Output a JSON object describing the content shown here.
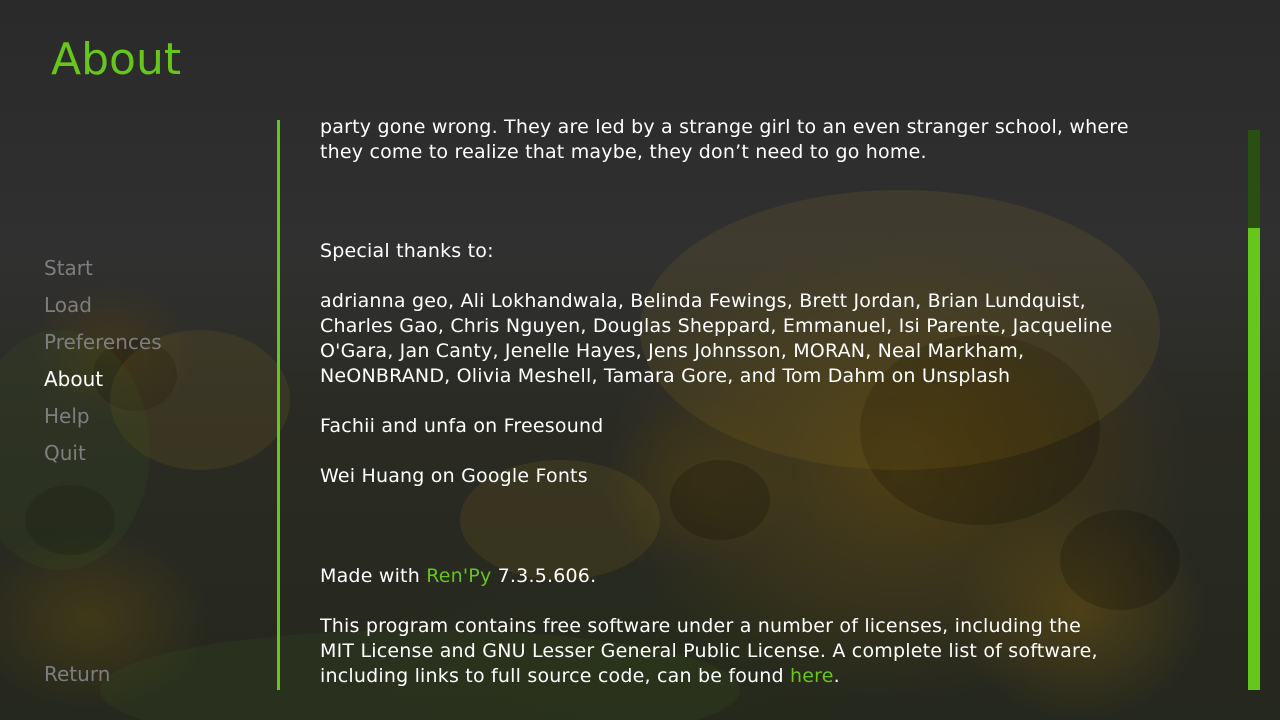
{
  "screen": {
    "title": "About"
  },
  "nav": {
    "items": [
      {
        "label": "Start"
      },
      {
        "label": "Load"
      },
      {
        "label": "Preferences"
      },
      {
        "label": "About"
      },
      {
        "label": "Help"
      },
      {
        "label": "Quit"
      }
    ],
    "selected": "About",
    "return_label": "Return"
  },
  "about": {
    "description_tail_line1": "party gone wrong. They are led by a strange girl to an even stranger school, where",
    "description_tail_line2": "they come to realize that maybe, they don’t need to go home.",
    "thanks_heading": "Special thanks to:",
    "unsplash_credits": [
      "adrianna geo, Ali Lokhandwala, Belinda Fewings, Brett Jordan, Brian Lundquist,",
      "Charles Gao, Chris Nguyen, Douglas Sheppard, Emmanuel, Isi Parente, Jacqueline",
      "O'Gara, Jan Canty, Jenelle Hayes, Jens Johnsson, MORAN, Neal Markham,",
      "NeONBRAND, Olivia Meshell, Tamara Gore, and Tom Dahm on Unsplash"
    ],
    "freesound_credit": "Fachii and unfa on Freesound",
    "fonts_credit": "Wei Huang on Google Fonts",
    "made_with": {
      "prefix": "Made with ",
      "link_label": "Ren'Py",
      "suffix": " 7.3.5.606."
    },
    "license": {
      "line1": "This program contains free software under a number of licenses, including the",
      "line2": "MIT License and GNU Lesser General Public License. A complete list of software,",
      "line3_prefix": "including links to full source code, can be found ",
      "line3_link": "here",
      "line3_suffix": "."
    }
  },
  "scrollbar": {
    "thumb_start_fraction": 0.175,
    "thumb_size_fraction": 0.825
  },
  "colors": {
    "accent": "#66c61c",
    "text": "#ffffff",
    "nav_idle": "#7e7e7e",
    "scroll_track": "#2a4f10"
  }
}
